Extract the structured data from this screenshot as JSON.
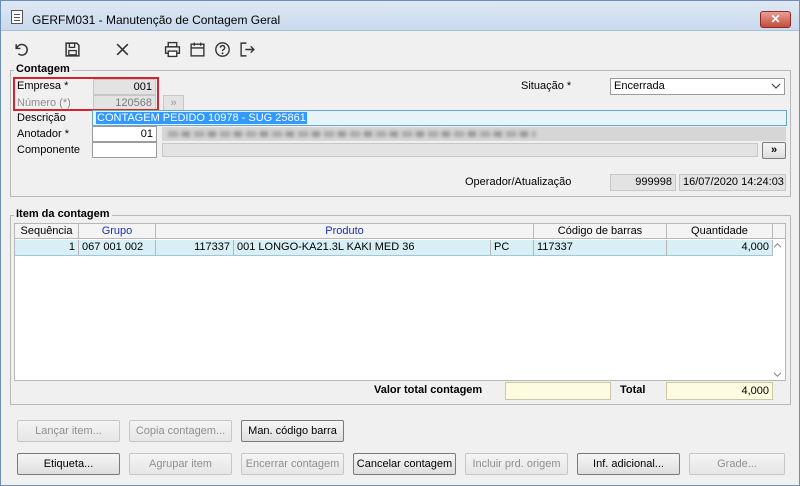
{
  "window": {
    "title": "GERFM031 - Manutenção de Contagem Geral",
    "close_label": "✕"
  },
  "toolbar": {
    "icons": [
      "undo-icon",
      "save-icon",
      "close-icon",
      "print-icon",
      "calendar-icon",
      "help-icon",
      "exit-icon"
    ]
  },
  "contagem": {
    "group_title": "Contagem",
    "empresa_label": "Empresa *",
    "empresa_value": "001",
    "numero_label": "Número (*)",
    "numero_value": "120568",
    "situacao_label": "Situação *",
    "situacao_value": "Encerrada",
    "descricao_label": "Descrição",
    "descricao_value": "CONTAGEM PEDIDO 10978 - SUG 25861",
    "anotador_label": "Anotador *",
    "anotador_value": "01",
    "componente_label": "Componente",
    "componente_value": "",
    "more_button": "»",
    "operador_label": "Operador/Atualização",
    "operador_value": "999998",
    "atualizacao_value": "16/07/2020 14:24:03"
  },
  "itens": {
    "group_title": "Item da contagem",
    "columns": [
      "Sequência",
      "Grupo",
      "Produto",
      "Código de barras",
      "Quantidade"
    ],
    "rows": [
      {
        "sequencia": "1",
        "grupo": "067 001 002",
        "produto_codigo": "117337",
        "produto_descricao": "001 LONGO-KA21.3L KAKI MED 36",
        "unidade": "PC",
        "codigo_barras": "117337",
        "quantidade": "4,000"
      }
    ],
    "valor_total_label": "Valor total contagem",
    "valor_total_value": "",
    "total_label": "Total",
    "total_value": "4,000"
  },
  "buttons": {
    "lancar_item": "Lançar item...",
    "copia_contagem": "Copia contagem...",
    "man_codigo_barra": "Man. código barra",
    "etiqueta": "Etiqueta...",
    "agrupar_item": "Agrupar item",
    "encerrar_contagem": "Encerrar contagem",
    "cancelar_contagem": "Cancelar contagem",
    "incluir_prd_origem": "Incluir prd. origem",
    "inf_adicional": "Inf. adicional...",
    "grade": "Grade..."
  }
}
